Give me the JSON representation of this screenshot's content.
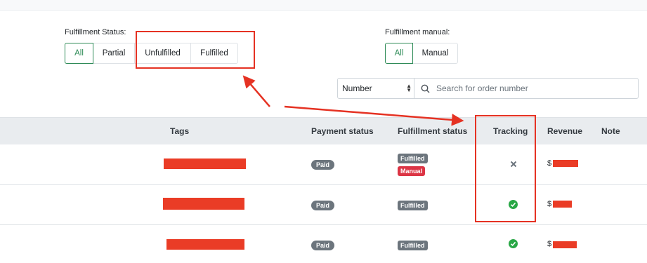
{
  "fulfillment_status": {
    "label": "Fulfillment Status:",
    "options": [
      "All",
      "Partial",
      "Unfulfilled",
      "Fulfilled"
    ],
    "selected": "All"
  },
  "fulfillment_manual": {
    "label": "Fulfillment manual:",
    "options": [
      "All",
      "Manual"
    ],
    "selected": "All"
  },
  "search": {
    "select_value": "Number",
    "placeholder": "Search for order number"
  },
  "table": {
    "columns": [
      "Tags",
      "Payment status",
      "Fulfillment status",
      "Tracking",
      "Revenue",
      "Note"
    ],
    "rows": [
      {
        "payment": "Paid",
        "fulfillment": [
          "Fulfilled",
          "Manual"
        ],
        "tracking": "x-icon",
        "revenue_prefix": "$"
      },
      {
        "payment": "Paid",
        "fulfillment": [
          "Fulfilled"
        ],
        "tracking": "check-circle-icon",
        "revenue_prefix": "$"
      },
      {
        "payment": "Paid",
        "fulfillment": [
          "Fulfilled"
        ],
        "tracking": "check-circle-icon",
        "revenue_prefix": "$"
      }
    ]
  },
  "colors": {
    "active_green": "#2e8b57",
    "annotation_red": "#e53223",
    "redaction_red": "#ea3c26",
    "check_green": "#28a745",
    "manual_badge": "#dc3545"
  }
}
